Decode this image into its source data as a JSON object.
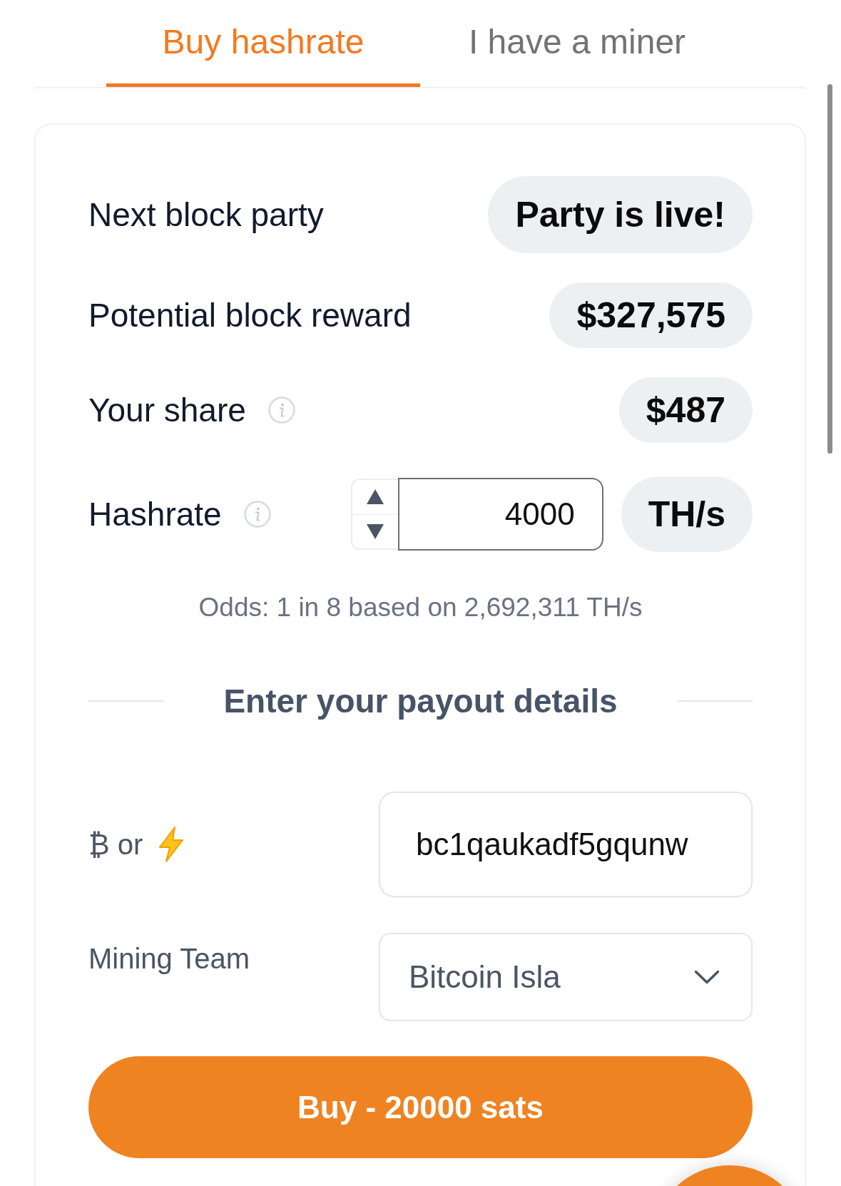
{
  "tabs": [
    {
      "label": "Buy hashrate",
      "selected": true
    },
    {
      "label": "I have a miner",
      "selected": false
    }
  ],
  "stats": [
    {
      "kind": "status",
      "label": "Next block party",
      "value": "Party is live!",
      "info": false
    },
    {
      "kind": "amount",
      "label": "Potential block reward",
      "value": "$327,575",
      "info": false
    },
    {
      "kind": "amount",
      "label": "Your share",
      "value": "$487",
      "info": true
    }
  ],
  "hashrate": {
    "label": "Hashrate",
    "info": true,
    "value": "4000",
    "unit": "TH/s"
  },
  "odds": "Odds: 1 in 8 based on 2,692,311 TH/s",
  "payout": {
    "heading": "Enter your payout details",
    "fields": [
      {
        "kind": "text",
        "label": "₿ or",
        "value": "bc1qaukadf5gqunw"
      },
      {
        "kind": "select",
        "label": "Mining Team",
        "value": "Bitcoin Isla"
      }
    ]
  },
  "buy_button": "Buy - 20000 sats"
}
